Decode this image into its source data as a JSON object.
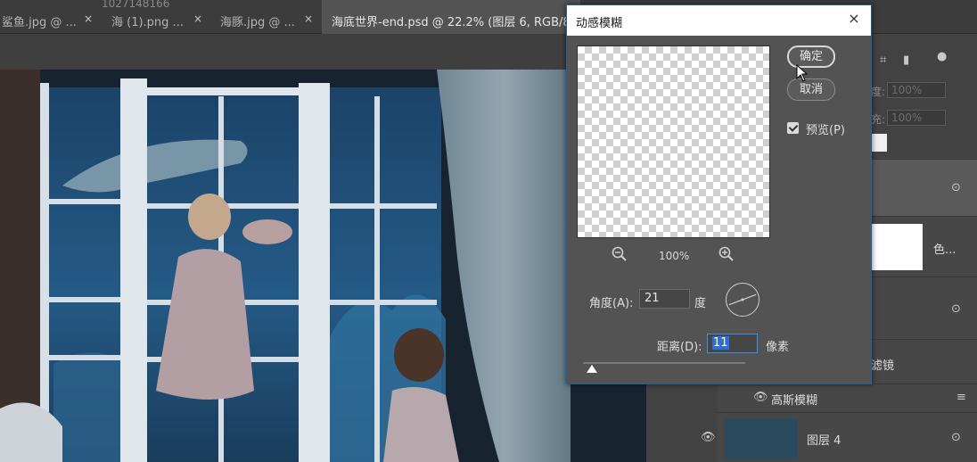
{
  "watermark": "1027148166",
  "tabs": [
    {
      "label": "鲨鱼.jpg @ ...",
      "close": "×"
    },
    {
      "label": "海 (1).png ...",
      "close": "×"
    },
    {
      "label": "海豚.jpg @ ...",
      "close": "×"
    },
    {
      "label": "海底世界-end.psd @ 22.2% (图层 6, RGB/8",
      "close": "×"
    }
  ],
  "panel": {
    "opacity_label": "度:",
    "opacity_value": "100%",
    "fill_label": "充:",
    "fill_value": "100%",
    "layers": [
      {
        "name": "色..."
      },
      {
        "name": "滤镜"
      },
      {
        "name": "高斯模糊"
      },
      {
        "name": "图层 4"
      }
    ]
  },
  "dialog": {
    "title": "动感模糊",
    "close": "×",
    "ok_label": "确定",
    "cancel_label": "取消",
    "preview_label": "预览(P)",
    "preview_checked": true,
    "zoom": "100%",
    "angle_label": "角度(A):",
    "angle_value": "21",
    "angle_unit": "度",
    "distance_label": "距离(D):",
    "distance_value": "11",
    "distance_unit": "像素"
  },
  "colors": {
    "accent": "#1f5ea8",
    "selection": "#2f6fcf",
    "dialog_bg": "#535353",
    "panel_bg": "#424242"
  }
}
